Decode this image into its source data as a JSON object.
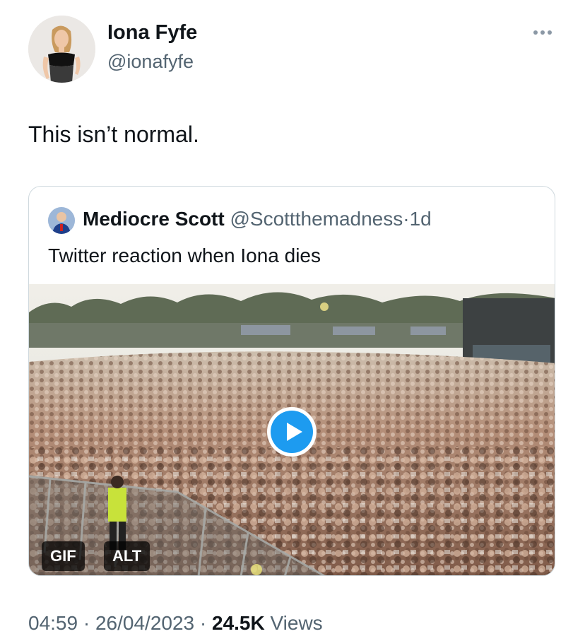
{
  "author": {
    "name": "Iona Fyfe",
    "handle": "@ionafyfe"
  },
  "tweet": {
    "text": "This isn’t normal."
  },
  "icons": {
    "more": "more-horizontal-icon",
    "play": "play-icon"
  },
  "quoted": {
    "name": "Mediocre Scott",
    "handle": "@Scottthemadness",
    "separator": "·",
    "time": "1d",
    "text": "Twitter reaction when Iona dies",
    "media": {
      "badge_gif": "GIF",
      "badge_alt": "ALT"
    }
  },
  "footer": {
    "time": "04:59",
    "sep1": "·",
    "date": "26/04/2023",
    "sep2": "·",
    "views_count": "24.5K",
    "views_label": "Views"
  },
  "colors": {
    "text_primary": "#0f1419",
    "text_secondary": "#536471",
    "border": "#cfd9de",
    "play_accent": "#1d9bf0"
  }
}
